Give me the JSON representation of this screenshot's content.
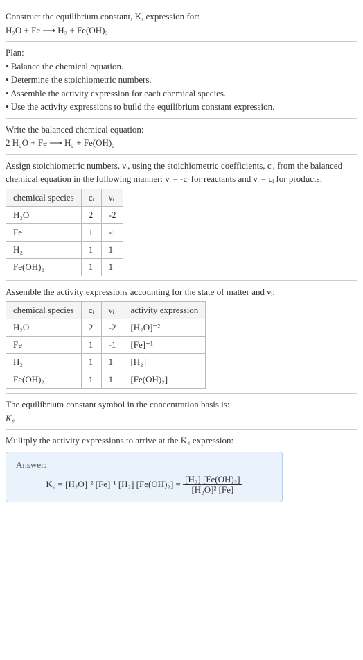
{
  "sec1": {
    "prompt": "Construct the equilibrium constant, K, expression for:",
    "equation": "H₂O + Fe ⟶ H₂ + Fe(OH)₂"
  },
  "plan": {
    "title": "Plan:",
    "b1": "• Balance the chemical equation.",
    "b2": "• Determine the stoichiometric numbers.",
    "b3": "• Assemble the activity expression for each chemical species.",
    "b4": "• Use the activity expressions to build the equilibrium constant expression."
  },
  "balanced": {
    "prompt": "Write the balanced chemical equation:",
    "equation": "2 H₂O + Fe ⟶ H₂ + Fe(OH)₂"
  },
  "stoich": {
    "intro1": "Assign stoichiometric numbers, νᵢ, using the stoichiometric coefficients, cᵢ, from the balanced chemical equation in the following manner: νᵢ = -cᵢ for reactants and νᵢ = cᵢ for products:",
    "headers": {
      "h1": "chemical species",
      "h2": "cᵢ",
      "h3": "νᵢ"
    },
    "rows": [
      {
        "sp": "H₂O",
        "c": "2",
        "v": "-2"
      },
      {
        "sp": "Fe",
        "c": "1",
        "v": "-1"
      },
      {
        "sp": "H₂",
        "c": "1",
        "v": "1"
      },
      {
        "sp": "Fe(OH)₂",
        "c": "1",
        "v": "1"
      }
    ]
  },
  "activity": {
    "intro": "Assemble the activity expressions accounting for the state of matter and νᵢ:",
    "headers": {
      "h1": "chemical species",
      "h2": "cᵢ",
      "h3": "νᵢ",
      "h4": "activity expression"
    },
    "rows": [
      {
        "sp": "H₂O",
        "c": "2",
        "v": "-2",
        "a": "[H₂O]⁻²"
      },
      {
        "sp": "Fe",
        "c": "1",
        "v": "-1",
        "a": "[Fe]⁻¹"
      },
      {
        "sp": "H₂",
        "c": "1",
        "v": "1",
        "a": "[H₂]"
      },
      {
        "sp": "Fe(OH)₂",
        "c": "1",
        "v": "1",
        "a": "[Fe(OH)₂]"
      }
    ]
  },
  "symbol": {
    "text": "The equilibrium constant symbol in the concentration basis is:",
    "kc": "K꜀"
  },
  "multiply": {
    "text": "Mulitply the activity expressions to arrive at the K꜀ expression:"
  },
  "answer": {
    "label": "Answer:",
    "lhs": "K꜀ = [H₂O]⁻² [Fe]⁻¹ [H₂] [Fe(OH)₂] = ",
    "num": "[H₂] [Fe(OH)₂]",
    "den": "[H₂O]² [Fe]"
  }
}
